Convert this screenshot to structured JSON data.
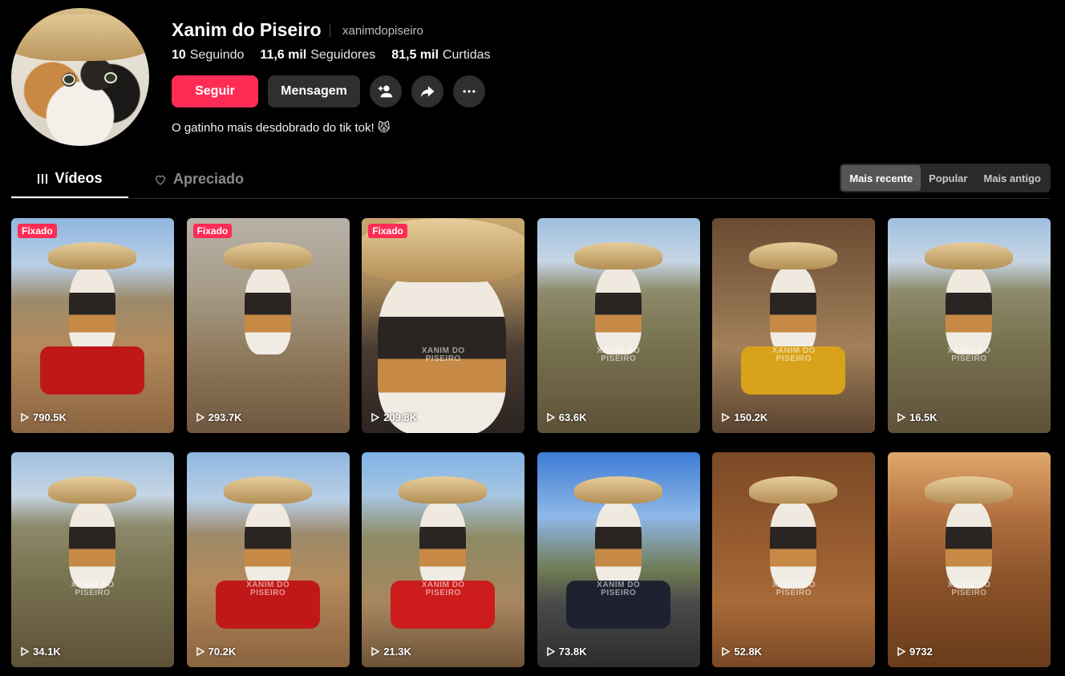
{
  "profile": {
    "name": "Xanim do Piseiro",
    "handle": "xanimdopiseiro",
    "stats": [
      {
        "value": "10",
        "label": "Seguindo"
      },
      {
        "value": "11,6 mil",
        "label": "Seguidores"
      },
      {
        "value": "81,5 mil",
        "label": "Curtidas"
      }
    ],
    "follow_label": "Seguir",
    "message_label": "Mensagem",
    "bio": "O gatinho mais desdobrado do tik tok! 😾"
  },
  "tabs": [
    {
      "label": "Vídeos",
      "icon": "grid-icon",
      "active": true
    },
    {
      "label": "Apreciado",
      "icon": "heart-icon",
      "active": false
    }
  ],
  "sort": [
    {
      "label": "Mais recente",
      "active": true
    },
    {
      "label": "Popular",
      "active": false
    },
    {
      "label": "Mais antigo",
      "active": false
    }
  ],
  "colors": {
    "accent": "#fe2c55",
    "background": "#000000",
    "button": "#2f2f2f"
  },
  "pinned_label": "Fixado",
  "watermark": [
    "XANIM DO",
    "PISEIRO"
  ],
  "videos": [
    {
      "views": "790.5K",
      "pinned": true,
      "scene": "desert-moto-red",
      "watermark": false
    },
    {
      "views": "293.7K",
      "pinned": true,
      "scene": "cattle-field",
      "watermark": false
    },
    {
      "views": "209.8K",
      "pinned": true,
      "scene": "closeup",
      "watermark": true
    },
    {
      "views": "63.6K",
      "pinned": false,
      "scene": "river-valley",
      "watermark": true
    },
    {
      "views": "150.2K",
      "pinned": false,
      "scene": "house-moto-yellow",
      "watermark": true
    },
    {
      "views": "16.5K",
      "pinned": false,
      "scene": "river-valley",
      "watermark": true
    },
    {
      "views": "34.1K",
      "pinned": false,
      "scene": "river-valley",
      "watermark": true
    },
    {
      "views": "70.2K",
      "pinned": false,
      "scene": "desert-moto-red",
      "watermark": true
    },
    {
      "views": "21.3K",
      "pinned": false,
      "scene": "dog-moto-red",
      "watermark": true
    },
    {
      "views": "73.8K",
      "pinned": false,
      "scene": "road-moto-black",
      "watermark": true
    },
    {
      "views": "52.8K",
      "pinned": false,
      "scene": "adobe-house",
      "watermark": true
    },
    {
      "views": "9732",
      "pinned": false,
      "scene": "sunset-house",
      "watermark": true
    }
  ]
}
